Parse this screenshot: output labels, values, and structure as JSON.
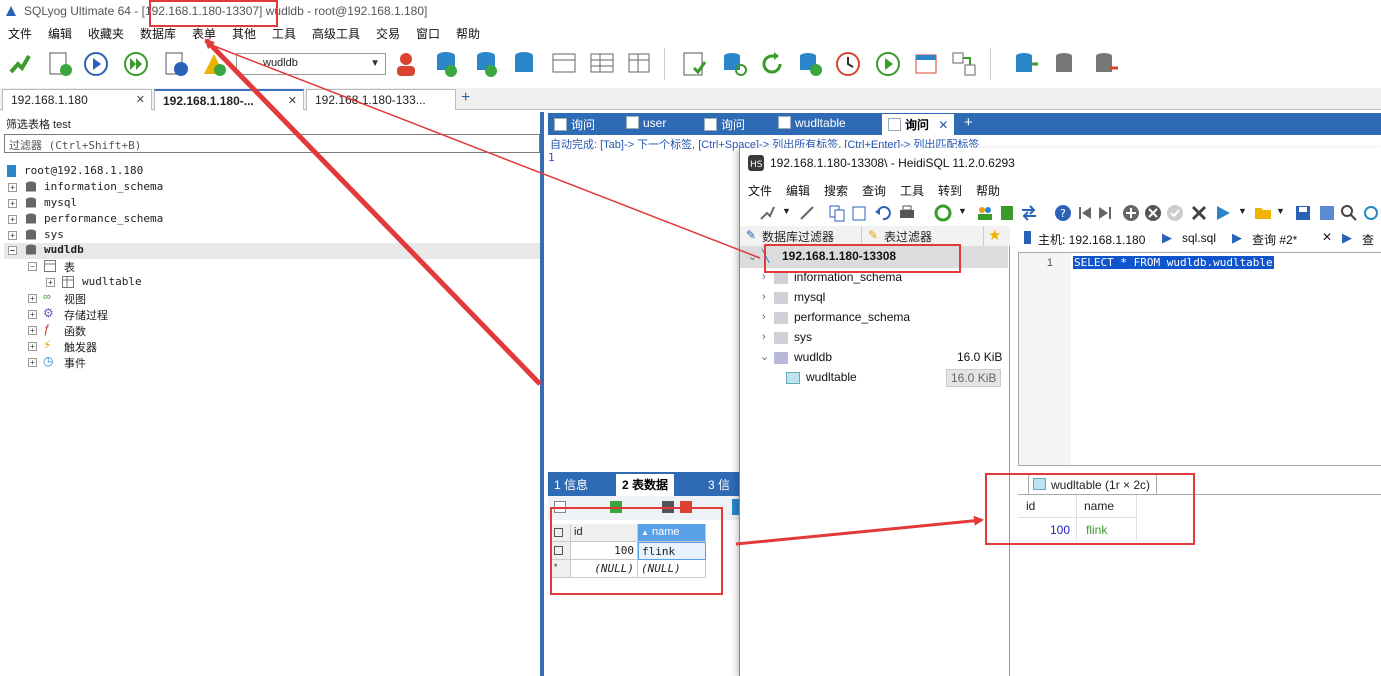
{
  "sqlyog": {
    "title_prefix": "SQLyog Ultimate 64 - ",
    "title_host": "[192.168.1.180-13307]",
    "title_suffix": " wudldb - root@192.168.1.180]",
    "menu": [
      "文件",
      "编辑",
      "收藏夹",
      "数据库",
      "表单",
      "其他",
      "工具",
      "高级工具",
      "交易",
      "窗口",
      "帮助"
    ],
    "db_select": "wudldb",
    "conn_tabs": [
      {
        "label": "192.168.1.180",
        "active": false
      },
      {
        "label": "192.168.1.180-...",
        "active": true
      },
      {
        "label": "192.168.1.180-133...",
        "active": false
      }
    ],
    "filter_label": "筛选表格 test",
    "filter_placeholder": "过滤器 (Ctrl+Shift+B)",
    "tree": {
      "root": "root@192.168.1.180",
      "databases": [
        "information_schema",
        "mysql",
        "performance_schema",
        "sys",
        "wudldb"
      ],
      "wudldb_children": [
        "表",
        "视图",
        "存储过程",
        "函数",
        "触发器",
        "事件"
      ],
      "table": "wudltable"
    },
    "query_tabs": [
      "询问",
      "user",
      "询问",
      "wudltable",
      "询问"
    ],
    "autocomplete_hint": "自动完成: [Tab]-> 下一个标签, [Ctrl+Space]-> 列出所有标签, [Ctrl+Enter]-> 列出匹配标签",
    "editor_line": "1",
    "result_tabs": [
      "1 信息",
      "2 表数据",
      "3 信"
    ],
    "grid": {
      "columns": [
        "id",
        "name"
      ],
      "rows": [
        [
          "100",
          "flink"
        ],
        [
          "(NULL)",
          "(NULL)"
        ]
      ],
      "new_row_marker": "*"
    }
  },
  "heidisql": {
    "title": "192.168.1.180-13308\\ - HeidiSQL 11.2.0.6293",
    "menu": [
      "文件",
      "编辑",
      "搜索",
      "查询",
      "工具",
      "转到",
      "帮助"
    ],
    "filters": [
      "数据库过滤器",
      "表过滤器"
    ],
    "tabs": [
      "主机: 192.168.1.180",
      "sql.sql",
      "查询 #2*",
      "查"
    ],
    "tree": {
      "session": "192.168.1.180-13308",
      "databases": [
        "information_schema",
        "mysql",
        "performance_schema",
        "sys",
        "wudldb"
      ],
      "wudldb_size": "16.0 KiB",
      "table": "wudltable",
      "table_size": "16.0 KiB"
    },
    "editor_line": "1",
    "sql": "SELECT * FROM wudldb.wudltable",
    "result_tab": "wudltable (1r × 2c)",
    "grid": {
      "columns": [
        "id",
        "name"
      ],
      "rows": [
        [
          "100",
          "flink"
        ]
      ]
    }
  },
  "colors": {
    "annotation_red": "#e23a3a",
    "sqlyog_blue": "#2f6bb5",
    "heidi_selection": "#1155cc"
  }
}
